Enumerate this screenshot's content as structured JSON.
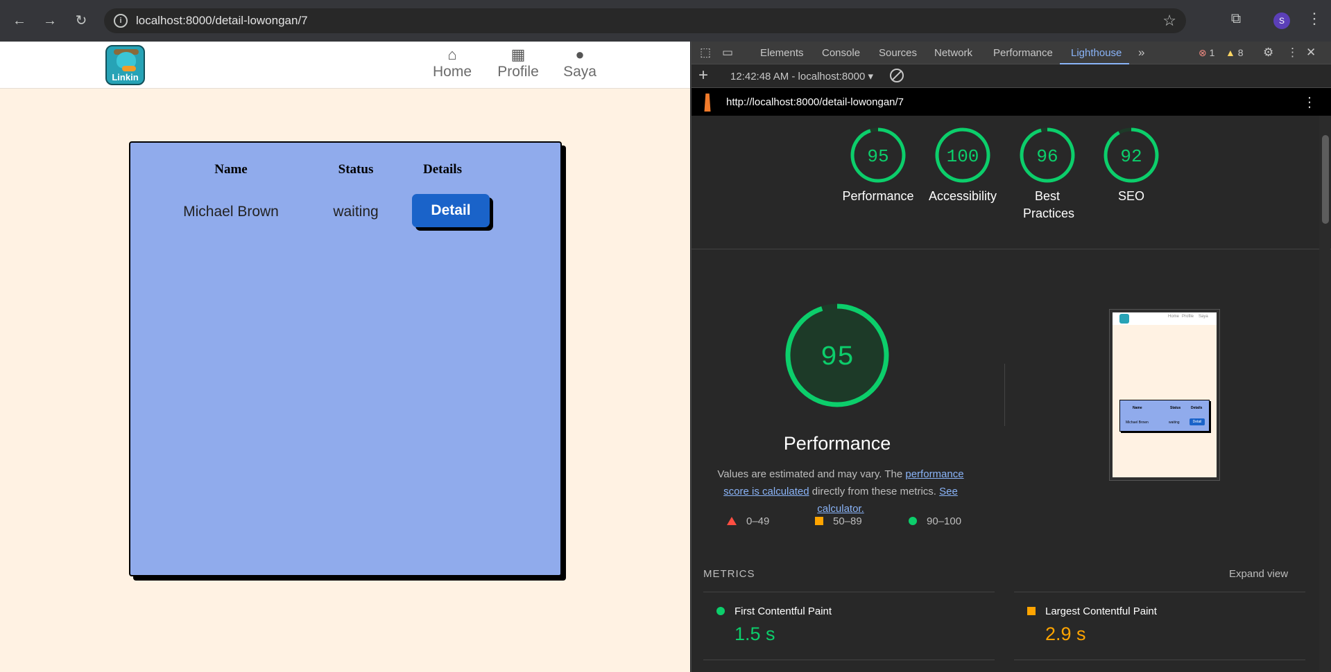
{
  "browser": {
    "url": "localhost:8000/detail-lowongan/7",
    "profile_initial": "S"
  },
  "site": {
    "logo_text": "Linkin",
    "nav": [
      {
        "label": "Home",
        "icon": "home-icon"
      },
      {
        "label": "Profile",
        "icon": "building-icon"
      },
      {
        "label": "Saya",
        "icon": "user-circle-icon"
      }
    ],
    "table": {
      "headers": [
        "Name",
        "Status",
        "Details"
      ],
      "rows": [
        {
          "name": "Michael Brown",
          "status": "waiting",
          "action": "Detail"
        }
      ]
    }
  },
  "devtools": {
    "tabs": [
      "Elements",
      "Console",
      "Sources",
      "Network",
      "Performance",
      "Lighthouse"
    ],
    "active_tab": "Lighthouse",
    "error_count": "1",
    "warning_count": "8",
    "report_select": "12:42:48 AM - localhost:8000 ▾",
    "report_url": "http://localhost:8000/detail-lowongan/7",
    "scores": [
      {
        "label": "Performance",
        "value": "95"
      },
      {
        "label": "Accessibility",
        "value": "100"
      },
      {
        "label": "Best Practices",
        "value": "96"
      },
      {
        "label": "SEO",
        "value": "92"
      }
    ],
    "perf_title": "Performance",
    "perf_desc_prefix": "Values are estimated and may vary. The ",
    "perf_desc_link1": "performance score is calculated",
    "perf_desc_middle": " directly from these metrics. ",
    "perf_desc_link2": "See calculator.",
    "legend": [
      "0–49",
      "50–89",
      "90–100"
    ],
    "metrics_heading": "METRICS",
    "expand_label": "Expand view",
    "metrics": [
      {
        "name": "First Contentful Paint",
        "value": "1.5 s",
        "rating": "pass"
      },
      {
        "name": "Largest Contentful Paint",
        "value": "2.9 s",
        "rating": "average"
      }
    ],
    "thumb": {
      "nav": [
        "Home",
        "Profile",
        "Saya"
      ],
      "headers": [
        "Name",
        "Status",
        "Details"
      ],
      "row": [
        "Michael Brown",
        "waiting",
        "Detail"
      ]
    },
    "colors": {
      "pass": "#0cce6b",
      "average": "#ffa400",
      "fail": "#ff4e42"
    }
  }
}
